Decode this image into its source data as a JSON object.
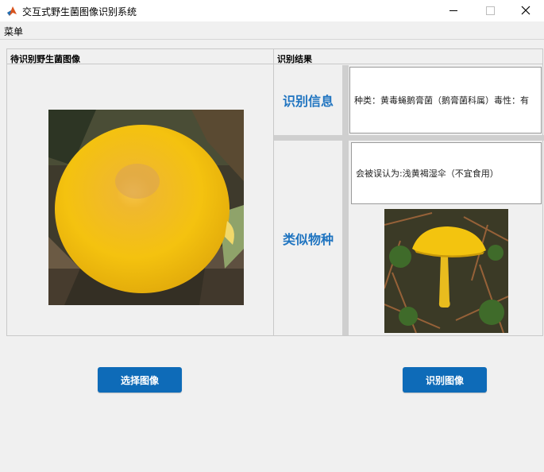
{
  "window": {
    "title": "交互式野生菌图像识别系统"
  },
  "menu": {
    "items": [
      "菜单"
    ]
  },
  "left_panel": {
    "title": "待识别野生菌图像"
  },
  "right_panel": {
    "title": "识别结果",
    "info_label": "识别信息",
    "info_text": "种类：黄毒蝇鹅膏菌（鹅膏菌科属）毒性：有",
    "similar_label": "类似物种",
    "similar_text": "会被误认为:浅黄褐湿伞（不宜食用）"
  },
  "buttons": {
    "select": "选择图像",
    "recognize": "识别图像"
  },
  "colors": {
    "accent": "#0e6bb8",
    "label": "#1f74c0"
  }
}
